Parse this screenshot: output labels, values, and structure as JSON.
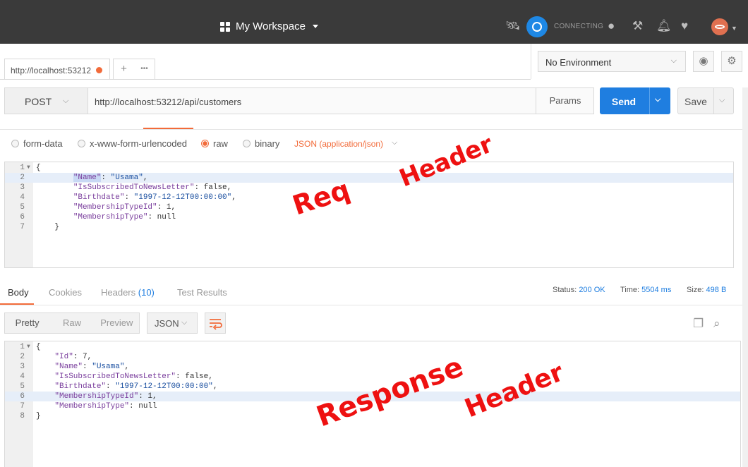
{
  "header": {
    "workspace_label": "My Workspace",
    "sync_status": "CONNECTING",
    "icons": [
      "satellite-icon",
      "sync-icon",
      "globe-icon",
      "wrench-icon",
      "bell-icon",
      "heart-icon",
      "avatar"
    ]
  },
  "tabs": {
    "active_tab_label": "http://localhost:53212",
    "add_label": "+",
    "more_label": "•••"
  },
  "environment": {
    "selected": "No Environment"
  },
  "request": {
    "method": "POST",
    "url": "http://localhost:53212/api/customers",
    "params_label": "Params",
    "send_label": "Send",
    "save_label": "Save"
  },
  "body_options": {
    "form_data": "form-data",
    "urlencoded": "x-www-form-urlencoded",
    "raw": "raw",
    "binary": "binary",
    "content_type": "JSON (application/json)",
    "selected": "raw"
  },
  "request_body": {
    "line_numbers": [
      "1",
      "2",
      "3",
      "4",
      "5",
      "6",
      "7"
    ],
    "lines": [
      [
        {
          "t": "p",
          "v": "{"
        }
      ],
      [
        {
          "t": "p",
          "v": "        "
        },
        {
          "t": "k",
          "v": "\"Name\"",
          "sel": true
        },
        {
          "t": "p",
          "v": ": "
        },
        {
          "t": "s",
          "v": "\"Usama\""
        },
        {
          "t": "p",
          "v": ","
        }
      ],
      [
        {
          "t": "p",
          "v": "        "
        },
        {
          "t": "k",
          "v": "\"IsSubscribedToNewsLetter\""
        },
        {
          "t": "p",
          "v": ": false,"
        }
      ],
      [
        {
          "t": "p",
          "v": "        "
        },
        {
          "t": "k",
          "v": "\"Birthdate\""
        },
        {
          "t": "p",
          "v": ": "
        },
        {
          "t": "s",
          "v": "\"1997-12-12T00:00:00\""
        },
        {
          "t": "p",
          "v": ","
        }
      ],
      [
        {
          "t": "p",
          "v": "        "
        },
        {
          "t": "k",
          "v": "\"MembershipTypeId\""
        },
        {
          "t": "p",
          "v": ": 1,"
        }
      ],
      [
        {
          "t": "p",
          "v": "        "
        },
        {
          "t": "k",
          "v": "\"MembershipType\""
        },
        {
          "t": "p",
          "v": ": null"
        }
      ],
      [
        {
          "t": "p",
          "v": "    }"
        }
      ]
    ]
  },
  "response_tabs": {
    "body": "Body",
    "cookies": "Cookies",
    "headers": "Headers",
    "headers_count": "(10)",
    "test_results": "Test Results"
  },
  "response_meta": {
    "status_label": "Status:",
    "status_value": "200 OK",
    "time_label": "Time:",
    "time_value": "5504 ms",
    "size_label": "Size:",
    "size_value": "498 B"
  },
  "response_format": {
    "pretty": "Pretty",
    "raw": "Raw",
    "preview": "Preview",
    "language": "JSON"
  },
  "response_body": {
    "line_numbers": [
      "1",
      "2",
      "3",
      "4",
      "5",
      "6",
      "7",
      "8"
    ],
    "lines": [
      [
        {
          "t": "p",
          "v": "{"
        }
      ],
      [
        {
          "t": "p",
          "v": "    "
        },
        {
          "t": "k",
          "v": "\"Id\""
        },
        {
          "t": "p",
          "v": ": 7,"
        }
      ],
      [
        {
          "t": "p",
          "v": "    "
        },
        {
          "t": "k",
          "v": "\"Name\""
        },
        {
          "t": "p",
          "v": ": "
        },
        {
          "t": "s",
          "v": "\"Usama\""
        },
        {
          "t": "p",
          "v": ","
        }
      ],
      [
        {
          "t": "p",
          "v": "    "
        },
        {
          "t": "k",
          "v": "\"IsSubscribedToNewsLetter\""
        },
        {
          "t": "p",
          "v": ": false,"
        }
      ],
      [
        {
          "t": "p",
          "v": "    "
        },
        {
          "t": "k",
          "v": "\"Birthdate\""
        },
        {
          "t": "p",
          "v": ": "
        },
        {
          "t": "s",
          "v": "\"1997-12-12T00:00:00\""
        },
        {
          "t": "p",
          "v": ","
        }
      ],
      [
        {
          "t": "p",
          "v": "    "
        },
        {
          "t": "k",
          "v": "\"MembershipTypeId\""
        },
        {
          "t": "p",
          "v": ": 1,"
        }
      ],
      [
        {
          "t": "p",
          "v": "    "
        },
        {
          "t": "k",
          "v": "\"MembershipType\""
        },
        {
          "t": "p",
          "v": ": null"
        }
      ],
      [
        {
          "t": "p",
          "v": "}"
        }
      ]
    ]
  },
  "annotations": {
    "req_word1": "Req",
    "req_word2": "Header",
    "resp_word1": "Response",
    "resp_word2": "Header",
    "color": "#e11111"
  },
  "colors": {
    "accent_orange": "#f26b3a",
    "send_blue": "#1f7ee0",
    "header_dark": "#3a3a3a"
  }
}
